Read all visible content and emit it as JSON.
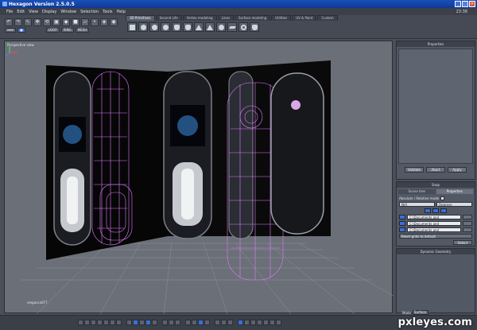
{
  "window": {
    "title": "Hexagon Version 2.5.0.5"
  },
  "menu": [
    "File",
    "Edit",
    "View",
    "Display",
    "Window",
    "Selection",
    "Tools",
    "Help"
  ],
  "clock": "23:38",
  "tabs": [
    {
      "label": "3D Primitives",
      "active": true
    },
    {
      "label": "Second Life",
      "active": false
    },
    {
      "label": "Vertex modeling",
      "active": false
    },
    {
      "label": "Lines",
      "active": false
    },
    {
      "label": "Surface modeling",
      "active": false
    },
    {
      "label": "Utilities",
      "active": false
    },
    {
      "label": "UV & Paint",
      "active": false
    },
    {
      "label": "Custom",
      "active": false
    }
  ],
  "toolbar_mini": [
    "LOOP",
    "RING",
    "MESH"
  ],
  "viewport": {
    "label": "Perspective view",
    "brand": "eleganceEFT"
  },
  "properties": {
    "title": "Properties",
    "buttons": [
      "Validate",
      "Abort",
      "Apply"
    ]
  },
  "snap": {
    "title": "Snap",
    "tabs": [
      {
        "label": "Scene tree",
        "active": false
      },
      {
        "label": "Properties",
        "active": true
      }
    ],
    "absolute_label": "Absolute / Relative mode",
    "rows": [
      {
        "left": "N/A",
        "right": "Degrees"
      },
      {
        "field": "C:\\Documents and"
      },
      {
        "field": "C:\\Documents and"
      },
      {
        "field": "C:\\Documents and"
      }
    ],
    "reset_label": "Reset grids to default",
    "select_label": "Select"
  },
  "dynamic": {
    "title": "Dynamic Geometry"
  },
  "status": {
    "mode_label": "Mode",
    "mode_value": "Surface"
  },
  "watermark": "pxleyes.com",
  "colors": {
    "accent": "#3a6fd6",
    "wireframe": "#e07bff",
    "titlebar": "#1a4fb8"
  }
}
